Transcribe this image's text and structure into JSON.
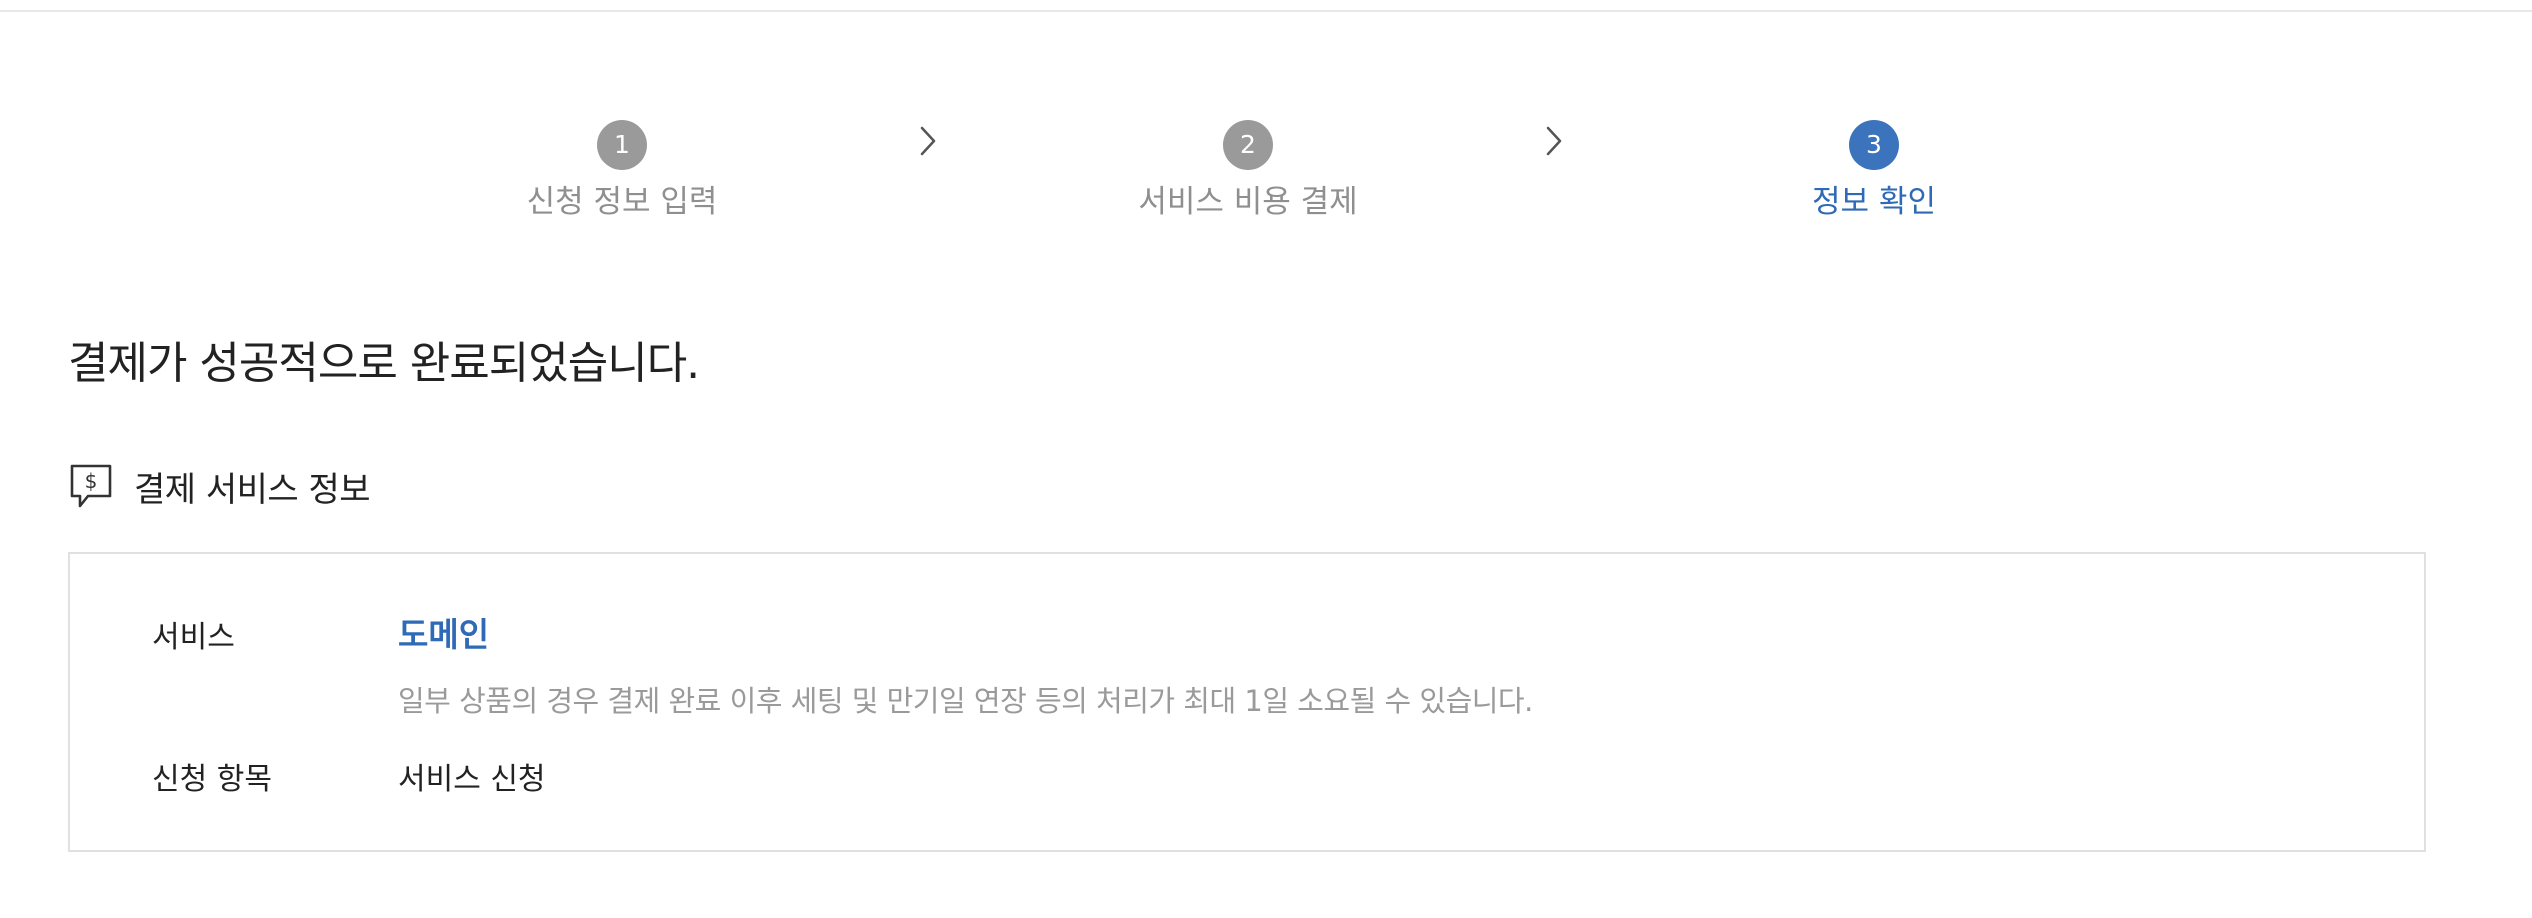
{
  "stepper": {
    "steps": [
      {
        "number": "1",
        "label": "신청 정보 입력",
        "state": "done"
      },
      {
        "number": "2",
        "label": "서비스 비용 결제",
        "state": "done"
      },
      {
        "number": "3",
        "label": "정보 확인",
        "state": "active"
      }
    ],
    "separator_icon": "chevron-right-icon"
  },
  "result": {
    "title": "결제가 성공적으로 완료되었습니다."
  },
  "section": {
    "icon": "payment-dollar-chat-icon",
    "title": "결제 서비스 정보"
  },
  "info": {
    "service_label": "서비스",
    "service_value": "도메인",
    "service_note": "일부 상품의 경우 결제 완료 이후 세팅 및 만기일 연장 등의 처리가 최대 1일 소요될 수 있습니다.",
    "item_label": "신청 항목",
    "item_value": "서비스 신청"
  },
  "colors": {
    "accent": "#3b74bc",
    "inactive_step": "#9a9a9a",
    "text": "#222222",
    "muted_text": "#9a9a9a",
    "border": "#e0e0e0"
  }
}
